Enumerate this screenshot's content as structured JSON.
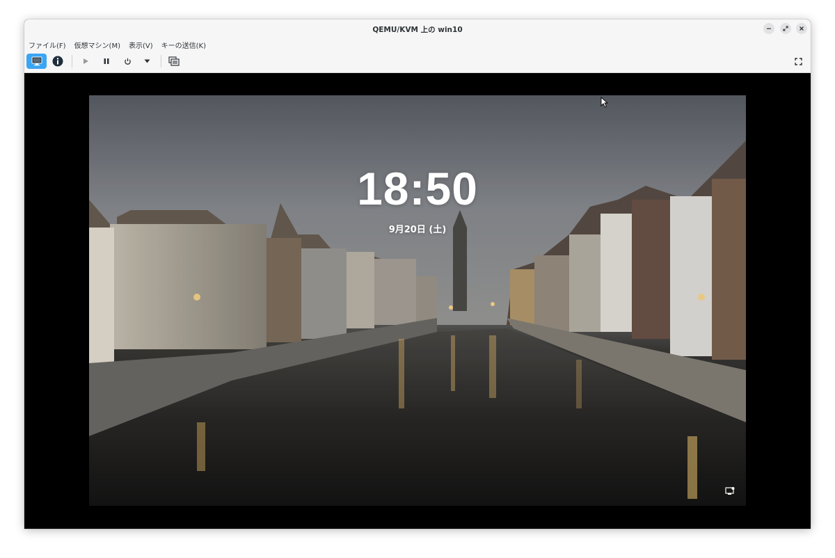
{
  "window": {
    "title": "QEMU/KVM 上の win10"
  },
  "menubar": {
    "items": [
      "ファイル(F)",
      "仮想マシン(M)",
      "表示(V)",
      "キーの送信(K)"
    ]
  },
  "toolbar": {
    "buttons": [
      {
        "icon": "console-icon",
        "active": true
      },
      {
        "icon": "details-info-icon"
      },
      {
        "icon": "run-play-icon"
      },
      {
        "icon": "pause-icon"
      },
      {
        "icon": "power-icon"
      },
      {
        "icon": "dropdown-arrow-icon"
      },
      {
        "icon": "snapshots-icon"
      },
      {
        "icon": "fullscreen-icon"
      }
    ],
    "accent": "#3aa5f5"
  },
  "lockscreen": {
    "time": "18:50",
    "date": "9月20日 (土)",
    "wallpaper": "canal-town-dusk",
    "status_icon": "network-icon"
  }
}
